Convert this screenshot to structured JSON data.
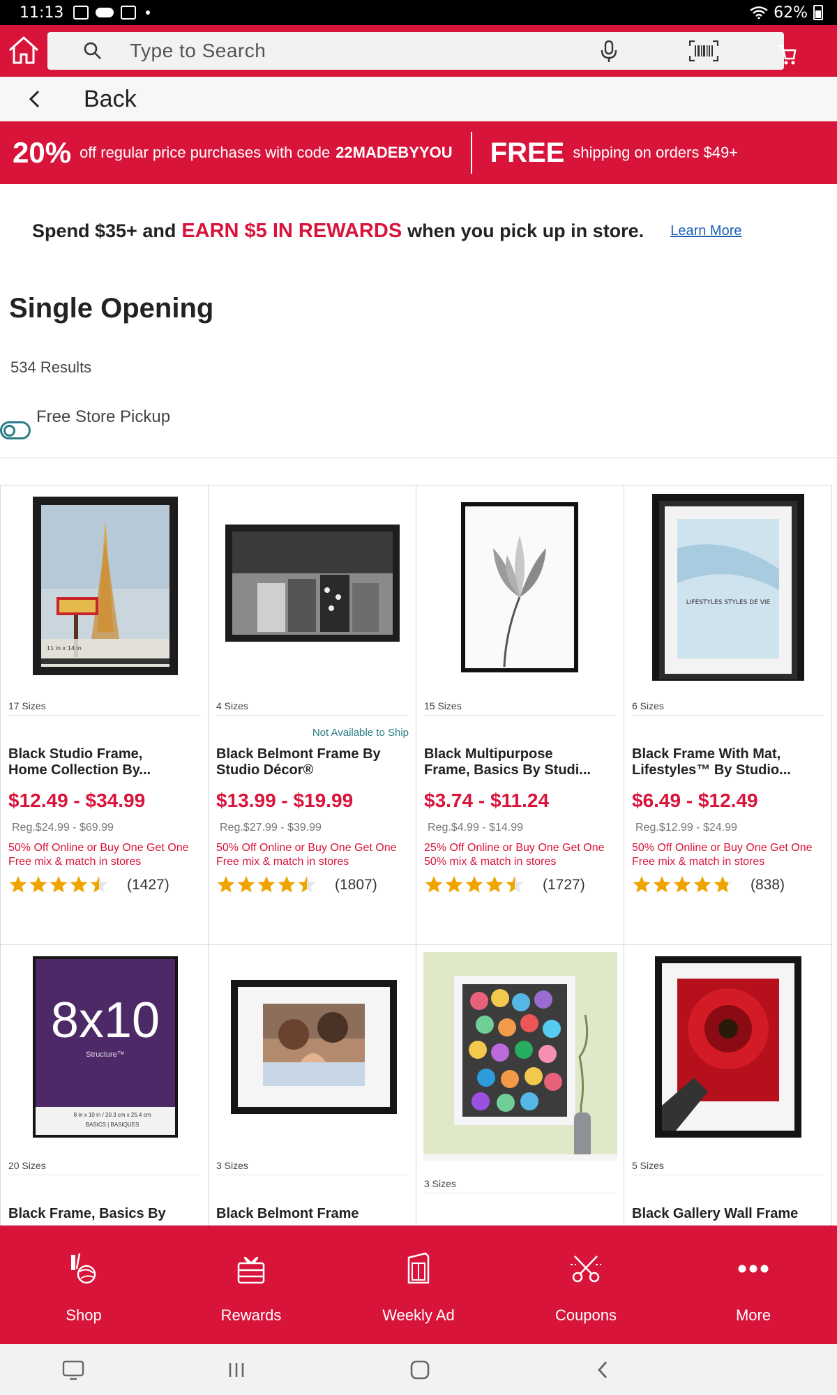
{
  "status_bar": {
    "time": "11:13",
    "battery": "62%"
  },
  "header": {
    "search_placeholder": "Type to Search"
  },
  "back": {
    "label": "Back"
  },
  "promo": {
    "percent": "20%",
    "text1": "off regular price purchases with code",
    "code": "22MADEBYYOU",
    "free": "FREE",
    "text2": "shipping on orders $49+"
  },
  "rewards_banner": {
    "part1": "Spend $35+ and",
    "part2": "EARN $5 IN REWARDS",
    "part3": "when you pick up in store.",
    "link": "Learn More"
  },
  "category": {
    "title": "Single Opening",
    "results": "534 Results",
    "pickup_label": "Free Store Pickup",
    "pickup_enabled": false
  },
  "products": [
    {
      "sizes": "17 Sizes",
      "ship_note": "",
      "name_line1": "Black Studio Frame,",
      "name_line2": "Home Collection By...",
      "price": "$12.49 - $34.99",
      "reg": "Reg.$24.99 - $69.99",
      "deal": "50% Off Online or Buy One Get One Free mix & match in stores",
      "rating": 4.5,
      "reviews": "(1427)"
    },
    {
      "sizes": "4 Sizes",
      "ship_note": "Not Available to Ship",
      "name_line1": "Black Belmont Frame By",
      "name_line2": "Studio Décor®",
      "price": "$13.99 - $19.99",
      "reg": "Reg.$27.99 - $39.99",
      "deal": "50% Off Online or Buy One Get One Free mix & match in stores",
      "rating": 4.5,
      "reviews": "(1807)"
    },
    {
      "sizes": "15 Sizes",
      "ship_note": "",
      "name_line1": "Black Multipurpose",
      "name_line2": "Frame, Basics By Studi...",
      "price": "$3.74 - $11.24",
      "reg": "Reg.$4.99 - $14.99",
      "deal": "25% Off Online or Buy One Get One 50% mix & match in stores",
      "rating": 4.5,
      "reviews": "(1727)"
    },
    {
      "sizes": "6 Sizes",
      "ship_note": "",
      "name_line1": "Black Frame With Mat,",
      "name_line2": "Lifestyles™ By Studio...",
      "price": "$6.49 - $12.49",
      "reg": "Reg.$12.99 - $24.99",
      "deal": "50% Off Online or Buy One Get One Free mix & match in stores",
      "rating": 4.8,
      "reviews": "(838)"
    },
    {
      "sizes": "20 Sizes",
      "name_line1": "Black Frame, Basics By"
    },
    {
      "sizes": "3 Sizes",
      "name_line1": "Black Belmont Frame"
    },
    {
      "sizes": "3 Sizes",
      "name_line1": ""
    },
    {
      "sizes": "5 Sizes",
      "name_line1": "Black Gallery Wall Frame"
    }
  ],
  "product_images": {
    "p1_caption": "11 in x 14 in",
    "p4_caption": "LIFESTYLES STYLES DE VIE",
    "p5_big": "8x10",
    "p5_small": "Structure™",
    "p5_size": "8 in x 10 in / 20.3 cm x 25.4 cm",
    "p5_line": "BASICS | BASIQUES"
  },
  "bottom_nav": [
    {
      "label": "Shop",
      "icon": "yarn-crafts-icon"
    },
    {
      "label": "Rewards",
      "icon": "gift-icon"
    },
    {
      "label": "Weekly Ad",
      "icon": "weekly-ad-icon"
    },
    {
      "label": "Coupons",
      "icon": "scissors-coupon-icon"
    },
    {
      "label": "More",
      "icon": "more-dots-icon"
    }
  ],
  "colors": {
    "brand_red": "#d8143a",
    "teal": "#2c7c86",
    "star": "#f0a400"
  }
}
